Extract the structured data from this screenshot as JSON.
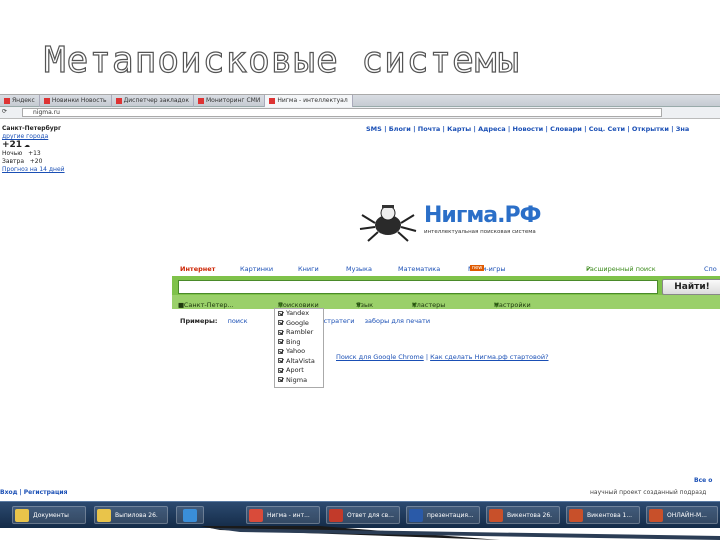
{
  "slide_title": "Метапоисковые системы",
  "browser": {
    "tabs": [
      {
        "label": "Яндекс",
        "active": false
      },
      {
        "label": "Новинки Новость",
        "active": false
      },
      {
        "label": "Диспетчер закладок",
        "active": false
      },
      {
        "label": "Мониторинг СМИ",
        "active": false
      },
      {
        "label": "Нигма - интеллектуал",
        "active": true
      }
    ],
    "url": "nigma.ru"
  },
  "weather": {
    "city": "Санкт-Петербург",
    "other_city": "другие города",
    "temp_now": "+21",
    "rows": [
      {
        "label": "Ночью",
        "value": "+13"
      },
      {
        "label": "Завтра",
        "value": "+20"
      }
    ],
    "forecast_link": "Прогноз на 14 дней"
  },
  "top_nav": "SMS | Блоги | Почта | Карты | Адреса | Новости | Словари | Соц. Сети | Открытки | Зна",
  "logo": {
    "brand": "Нигма.РФ",
    "tagline": "интеллектуальная поисковая система"
  },
  "categories": {
    "items": [
      "Интернет",
      "Картинки",
      "Книги",
      "Музыка",
      "Математика",
      "Мини-игры"
    ],
    "new_badge": "new",
    "extended": "Расширенный поиск",
    "right_clip": "Спо"
  },
  "search": {
    "value": "",
    "button": "Найти!"
  },
  "filters": {
    "region": "в Санкт-Петер...",
    "items": [
      "Поисковики",
      "Язык",
      "Кластеры",
      "Настройки"
    ]
  },
  "examples": {
    "label": "Примеры:",
    "items": [
      "поиск",
      "стратеги",
      "заборы для печати"
    ]
  },
  "engines": [
    "Yandex",
    "Google",
    "Rambler",
    "Bing",
    "Yahoo",
    "AltaVista",
    "Aport",
    "Nigma"
  ],
  "chrome_links": {
    "left": "Поиск для Google Chrome",
    "right": "Как сделать Нигма.рф стартовой?"
  },
  "footer": {
    "left": "Вход | Регистрация",
    "right_top": "Все о",
    "right_bottom": "научный проект созданный подразд"
  },
  "taskbar": {
    "items": [
      {
        "label": "Документы",
        "icon": "folder-icon",
        "color": "#e9c44a"
      },
      {
        "label": "Выпилова 26.",
        "icon": "folder-icon",
        "color": "#e9c44a"
      },
      {
        "label": "",
        "icon": "ie-icon",
        "color": "#3a8ed8"
      },
      {
        "label": "Нигма - инт...",
        "icon": "chrome-icon",
        "color": "#d94b3a"
      },
      {
        "label": "Ответ для св...",
        "icon": "mail-icon",
        "color": "#c23a2a"
      },
      {
        "label": "презентация...",
        "icon": "word-icon",
        "color": "#2a5aa8"
      },
      {
        "label": "Викентова 26.",
        "icon": "powerpoint-icon",
        "color": "#c8502a"
      },
      {
        "label": "Викентова 1...",
        "icon": "powerpoint-icon",
        "color": "#c8502a"
      },
      {
        "label": "ОНЛАЙН-М...",
        "icon": "powerpoint-icon",
        "color": "#c8502a"
      }
    ]
  }
}
